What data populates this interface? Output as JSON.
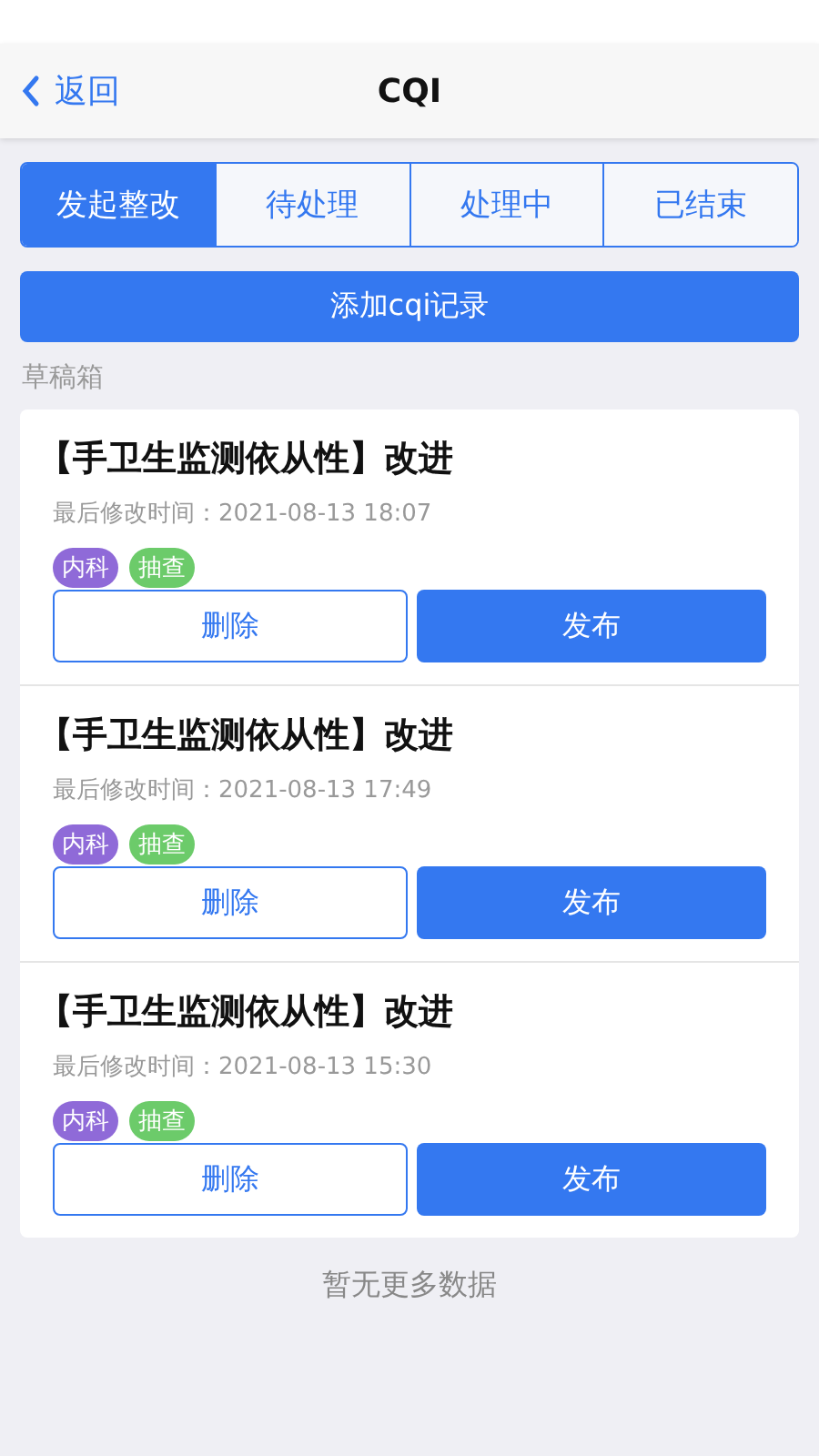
{
  "nav": {
    "back": "返回",
    "title": "CQI"
  },
  "tabs": [
    {
      "label": "发起整改",
      "selected": true
    },
    {
      "label": "待处理",
      "selected": false
    },
    {
      "label": "处理中",
      "selected": false
    },
    {
      "label": "已结束",
      "selected": false
    }
  ],
  "add_button": "添加cqi记录",
  "section_label": "草稿箱",
  "drafts": [
    {
      "title": "【手卫生监测依从性】改进",
      "modified": "最后修改时间：2021-08-13 18:07",
      "tags": [
        {
          "label": "内科",
          "color": "#8f6ad8"
        },
        {
          "label": "抽查",
          "color": "#6ccb6a"
        }
      ],
      "delete": "删除",
      "publish": "发布"
    },
    {
      "title": "【手卫生监测依从性】改进",
      "modified": "最后修改时间：2021-08-13 17:49",
      "tags": [
        {
          "label": "内科",
          "color": "#8f6ad8"
        },
        {
          "label": "抽查",
          "color": "#6ccb6a"
        }
      ],
      "delete": "删除",
      "publish": "发布"
    },
    {
      "title": "【手卫生监测依从性】改进",
      "modified": "最后修改时间：2021-08-13 15:30",
      "tags": [
        {
          "label": "内科",
          "color": "#8f6ad8"
        },
        {
          "label": "抽查",
          "color": "#6ccb6a"
        }
      ],
      "delete": "删除",
      "publish": "发布"
    }
  ],
  "footer": "暂无更多数据"
}
